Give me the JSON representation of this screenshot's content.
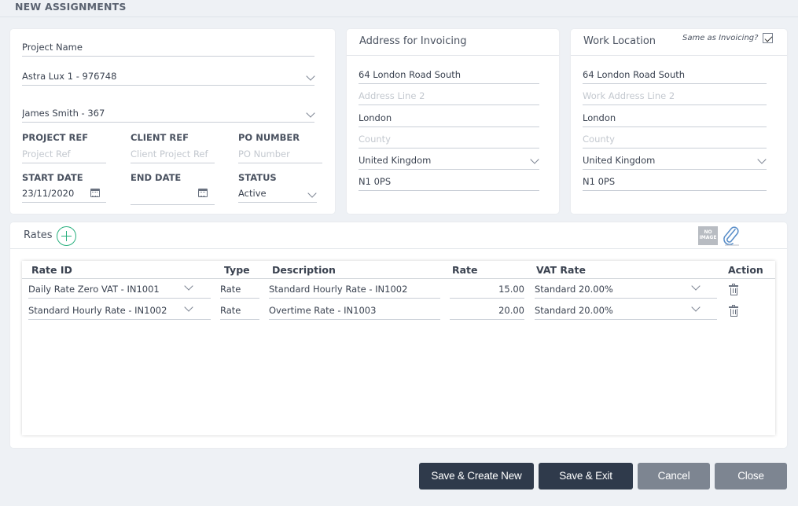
{
  "page": {
    "title": "NEW ASSIGNMENTS"
  },
  "assignment": {
    "project_name_label": "Project Name",
    "project_value": "Astra Lux 1 - 976748",
    "person_value": "James Smith - 367",
    "project_ref_label": "PROJECT REF",
    "project_ref_placeholder": "Project Ref",
    "client_ref_label": "CLIENT REF",
    "client_ref_placeholder": "Client Project Ref",
    "po_number_label": "PO NUMBER",
    "po_number_placeholder": "PO Number",
    "start_date_label": "START DATE",
    "start_date_value": "23/11/2020",
    "end_date_label": "END DATE",
    "end_date_value": "",
    "status_label": "STATUS",
    "status_value": "Active"
  },
  "invoicing": {
    "title": "Address for Invoicing",
    "line1": "64 London Road South",
    "line2_placeholder": "Address Line 2",
    "city": "London",
    "county_placeholder": "County",
    "country": "United Kingdom",
    "postcode": "N1 0PS"
  },
  "work_location": {
    "title": "Work Location",
    "same_as_label": "Same as Invoicing?",
    "same_as_checked": true,
    "line1": "64 London Road South",
    "line2_placeholder": "Work Address Line 2",
    "city": "London",
    "county_placeholder": "County",
    "country": "United Kingdom",
    "postcode": "N1 0PS"
  },
  "rates": {
    "title": "Rates",
    "no_image_text": "NO IMAGE",
    "columns": [
      "Rate ID",
      "Type",
      "Description",
      "Rate",
      "VAT Rate",
      "Action"
    ],
    "rows": [
      {
        "rate_id": "Daily Rate Zero VAT - IN1001",
        "type": "Rate",
        "description": "Standard Hourly Rate - IN1002",
        "rate": "15.00",
        "vat": "Standard 20.00%"
      },
      {
        "rate_id": "Standard Hourly Rate - IN1002",
        "type": "Rate",
        "description": "Overtime Rate - IN1003",
        "rate": "20.00",
        "vat": "Standard 20.00%"
      }
    ]
  },
  "buttons": {
    "save_create_new": "Save & Create New",
    "save_exit": "Save & Exit",
    "cancel": "Cancel",
    "close": "Close"
  },
  "colors": {
    "primary_button": "#2f3a4b",
    "secondary_button": "#7d8591",
    "add_accent": "#29b07e"
  }
}
